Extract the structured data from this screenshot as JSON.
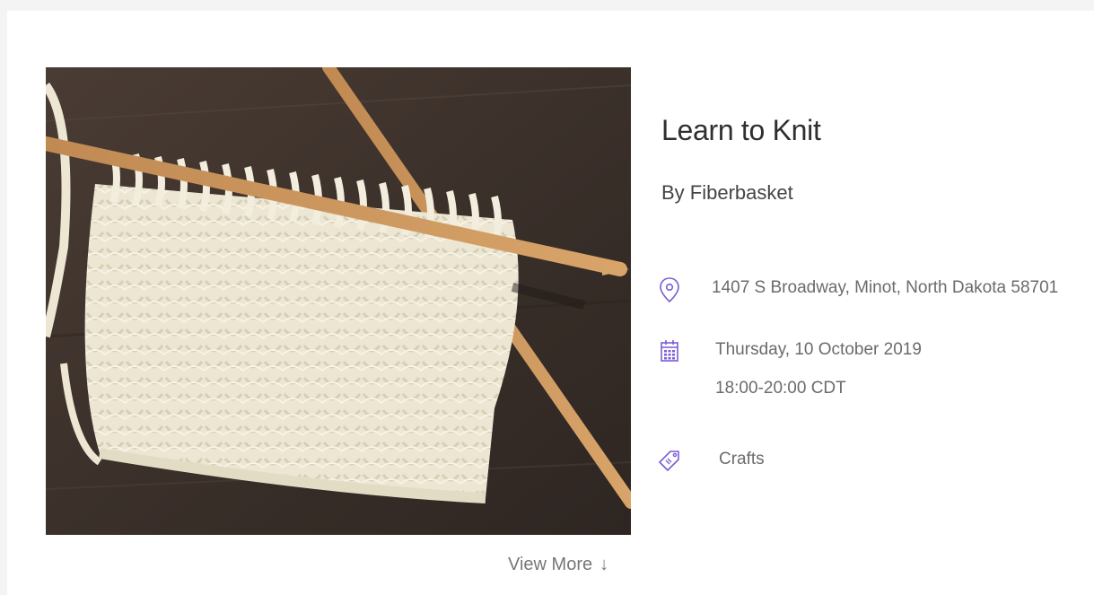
{
  "event": {
    "title": "Learn to Knit",
    "organizer": "By Fiberbasket",
    "location": "1407 S Broadway, Minot, North Dakota 58701",
    "date": "Thursday, 10 October 2019",
    "time": "18:00-20:00 CDT",
    "category": "Crafts"
  },
  "icons": {
    "location": "map-pin-icon",
    "date": "calendar-icon",
    "category": "tag-icon",
    "view_more": "arrow-down-icon"
  },
  "actions": {
    "view_more_label": "View More",
    "view_more_arrow": "↓"
  },
  "colors": {
    "accent": "#7b5cd6"
  }
}
